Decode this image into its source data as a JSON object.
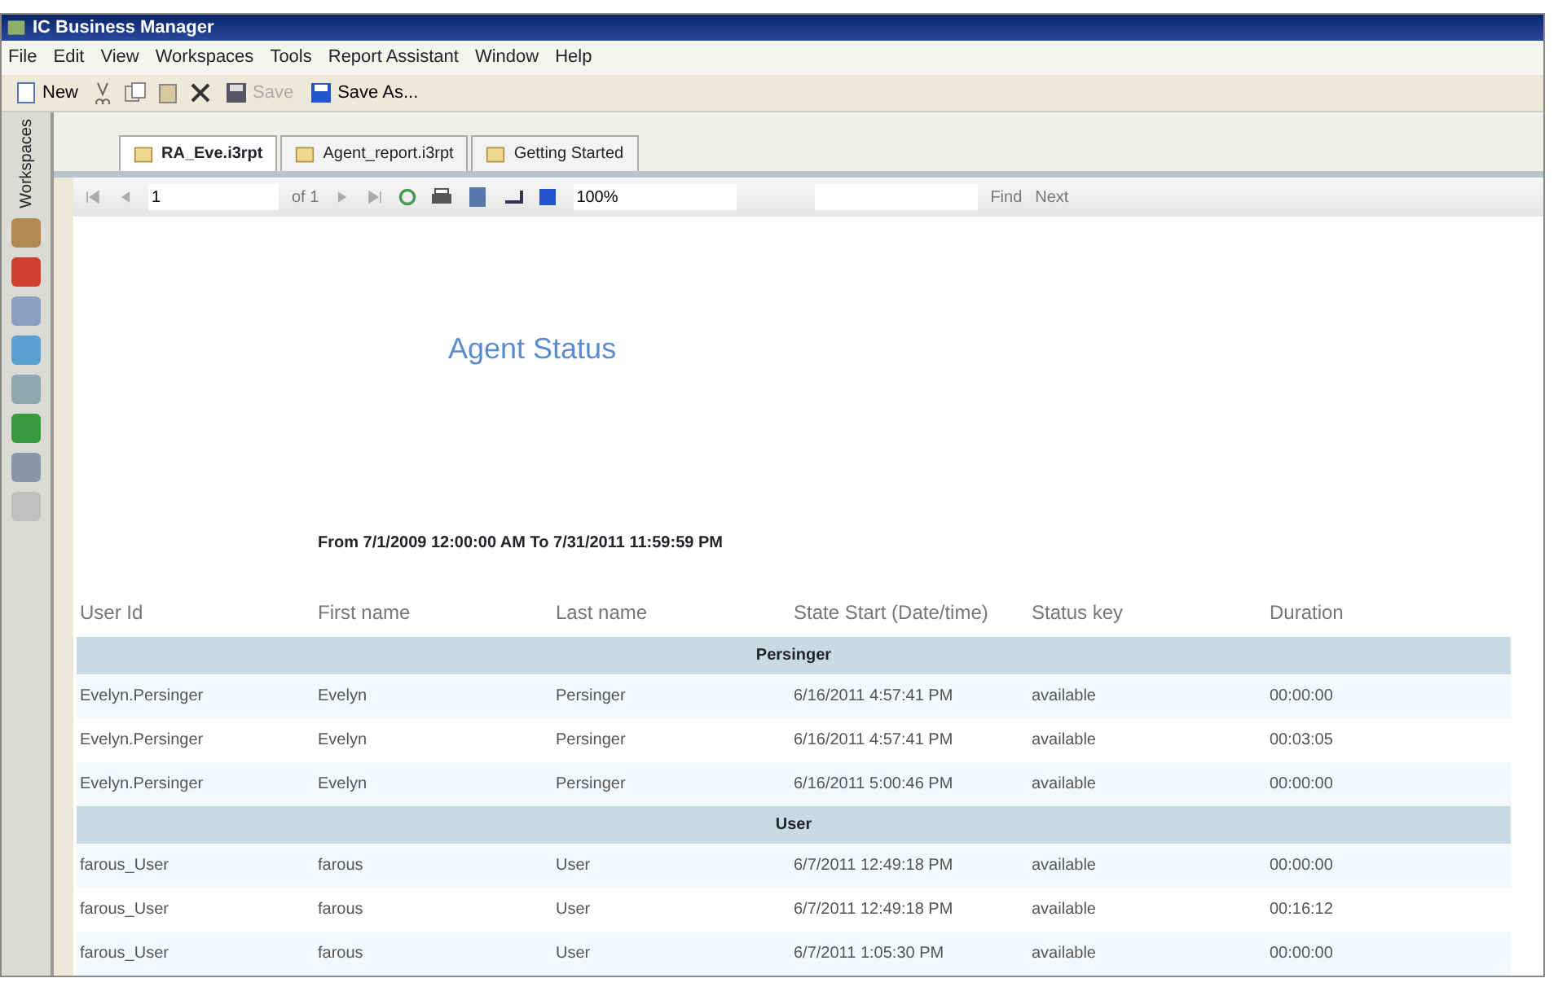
{
  "window": {
    "title": "IC Business Manager"
  },
  "menu": [
    "File",
    "Edit",
    "View",
    "Workspaces",
    "Tools",
    "Report Assistant",
    "Window",
    "Help"
  ],
  "toolbar": [
    {
      "kind": "new",
      "label": "New"
    },
    {
      "kind": "save",
      "label": "Save"
    },
    {
      "kind": "saveas",
      "label": "Save As..."
    }
  ],
  "sidebar": {
    "title": "Workspaces"
  },
  "tabs": [
    {
      "label": "RA_Eve.i3rpt",
      "selected": true
    },
    {
      "label": "Agent_report.i3rpt",
      "selected": false
    },
    {
      "label": "Getting Started",
      "selected": false
    }
  ],
  "report_toolbar": {
    "page": "1",
    "of": "of 1",
    "zoom": "100%",
    "find": "Find",
    "next": "Next"
  },
  "report": {
    "title": "Agent Status",
    "range": "From 7/1/2009 12:00:00 AM  To 7/31/2011 11:59:59 PM",
    "columns": [
      "User Id",
      "First name",
      "Last name",
      "State Start (Date/time)",
      "Status key",
      "Duration"
    ],
    "rows": [
      {
        "kind": "group",
        "label": "Persinger"
      },
      {
        "kind": "row",
        "cells": [
          "Evelyn.Persinger",
          "Evelyn",
          "Persinger",
          "6/16/2011 4:57:41 PM",
          "available",
          "00:00:00"
        ]
      },
      {
        "kind": "row",
        "cells": [
          "Evelyn.Persinger",
          "Evelyn",
          "Persinger",
          "6/16/2011 4:57:41 PM",
          "available",
          "00:03:05"
        ]
      },
      {
        "kind": "row",
        "cells": [
          "Evelyn.Persinger",
          "Evelyn",
          "Persinger",
          "6/16/2011 5:00:46 PM",
          "available",
          "00:00:00"
        ]
      },
      {
        "kind": "group",
        "label": "User"
      },
      {
        "kind": "row",
        "cells": [
          "farous_User",
          "farous",
          "User",
          "6/7/2011 12:49:18 PM",
          "available",
          "00:00:00"
        ]
      },
      {
        "kind": "row",
        "cells": [
          "farous_User",
          "farous",
          "User",
          "6/7/2011 12:49:18 PM",
          "available",
          "00:16:12"
        ]
      },
      {
        "kind": "row",
        "cells": [
          "farous_User",
          "farous",
          "User",
          "6/7/2011 1:05:30 PM",
          "available",
          "00:00:00"
        ]
      }
    ]
  }
}
